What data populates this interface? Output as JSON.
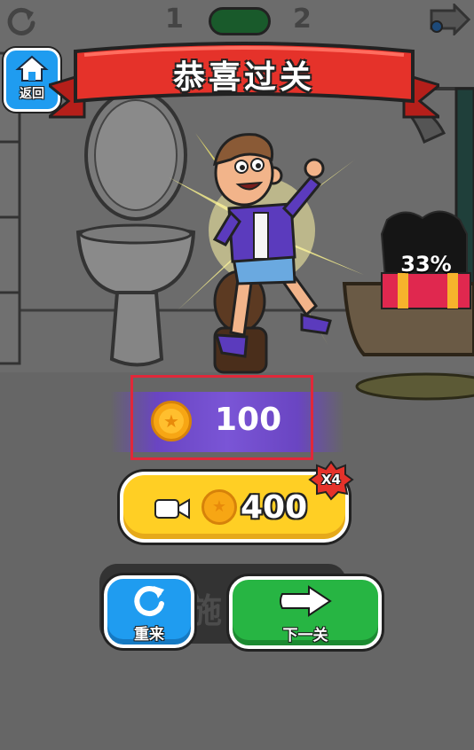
{
  "header": {
    "level_current": "1",
    "level_next": "2",
    "back_label": "返回"
  },
  "banner": {
    "title": "恭喜过关"
  },
  "gift": {
    "progress_text": "33%",
    "progress": 0.33
  },
  "reward": {
    "coin_amount": "100"
  },
  "video_reward": {
    "coin_amount": "400",
    "multiplier": "X4"
  },
  "obscured_text": "施",
  "buttons": {
    "retry_label": "重来",
    "next_label": "下一关"
  },
  "colors": {
    "banner_red": "#e5322a",
    "reward_purple": "#6a45c2",
    "video_yellow": "#ffcf24",
    "next_green": "#27b543",
    "retry_blue": "#1f9cf0",
    "coin_gold": "#f7a614",
    "highlight_red": "#e0283a"
  }
}
